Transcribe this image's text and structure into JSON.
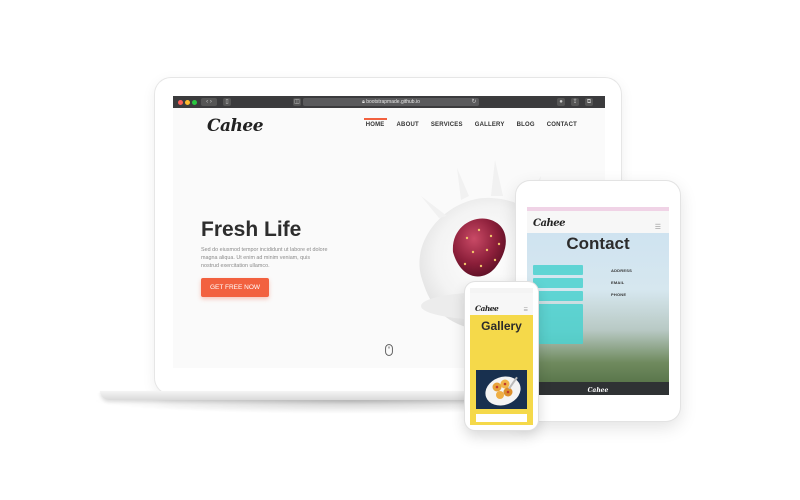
{
  "desktop": {
    "browser": {
      "url": "bootstrapmade.github.io"
    },
    "logo": "Cahee",
    "nav": [
      {
        "label": "HOME",
        "active": true
      },
      {
        "label": "ABOUT",
        "active": false
      },
      {
        "label": "SERVICES",
        "active": false
      },
      {
        "label": "GALLERY",
        "active": false
      },
      {
        "label": "BLOG",
        "active": false
      },
      {
        "label": "CONTACT",
        "active": false
      }
    ],
    "hero": {
      "title": "Fresh Life",
      "text": "Sed do eiusmod tempor incididunt ut labore et dolore magna aliqua. Ut enim ad minim veniam, quis nostrud exercitation ullamco.",
      "button": "GET FREE NOW"
    }
  },
  "tablet": {
    "logo": "Cahee",
    "title": "Contact",
    "info": [
      {
        "label": "ADDRESS"
      },
      {
        "label": "EMAIL"
      },
      {
        "label": "PHONE"
      }
    ],
    "footer_logo": "Cahee"
  },
  "phone": {
    "logo": "Cahee",
    "title": "Gallery"
  },
  "colors": {
    "accent": "#f2613f",
    "teal": "#4ad1cf",
    "yellow": "#f5d94a"
  }
}
